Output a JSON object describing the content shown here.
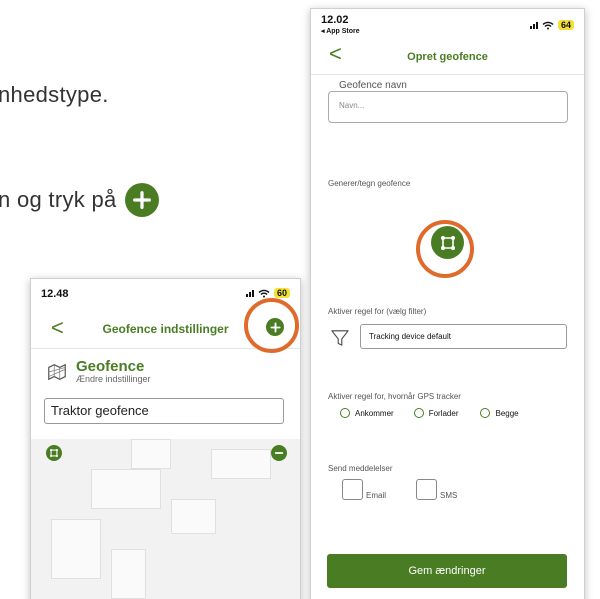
{
  "background_text": {
    "line1": "nhedstype.",
    "line2": "n og tryk på"
  },
  "left_phone": {
    "status_time": "12.48",
    "battery": "60",
    "nav_title": "Geofence indstillinger",
    "back_symbol": "<",
    "geofence_title": "Geofence",
    "geofence_subtitle": "Ændre indstillinger",
    "geofence_name": "Traktor geofence"
  },
  "right_phone": {
    "status_time": "12.02",
    "app_store_back": "◂ App Store",
    "battery": "64",
    "back_symbol": "<",
    "nav_title": "Opret geofence",
    "name_label": "Geofence navn",
    "name_placeholder": "Navn...",
    "draw_label": "Generer/tegn geofence",
    "filter_label": "Aktiver regel for (vælg filter)",
    "filter_value": "Tracking device default",
    "gps_label": "Aktiver regel for, hvornår GPS tracker",
    "gps_options": [
      "Ankommer",
      "Forlader",
      "Begge"
    ],
    "notify_label": "Send meddelelser",
    "notify_options": [
      "Email",
      "SMS"
    ],
    "save_label": "Gem ændringer"
  },
  "colors": {
    "accent": "#4a7d23",
    "highlight_ring": "#e06a2c",
    "battery": "#f3e03a"
  },
  "icons": [
    "plus-icon",
    "chevron-left-icon",
    "geofence-map-icon",
    "polygon-draw-icon",
    "minus-icon",
    "filter-funnel-icon",
    "signal-icon",
    "wifi-icon",
    "battery-icon"
  ]
}
